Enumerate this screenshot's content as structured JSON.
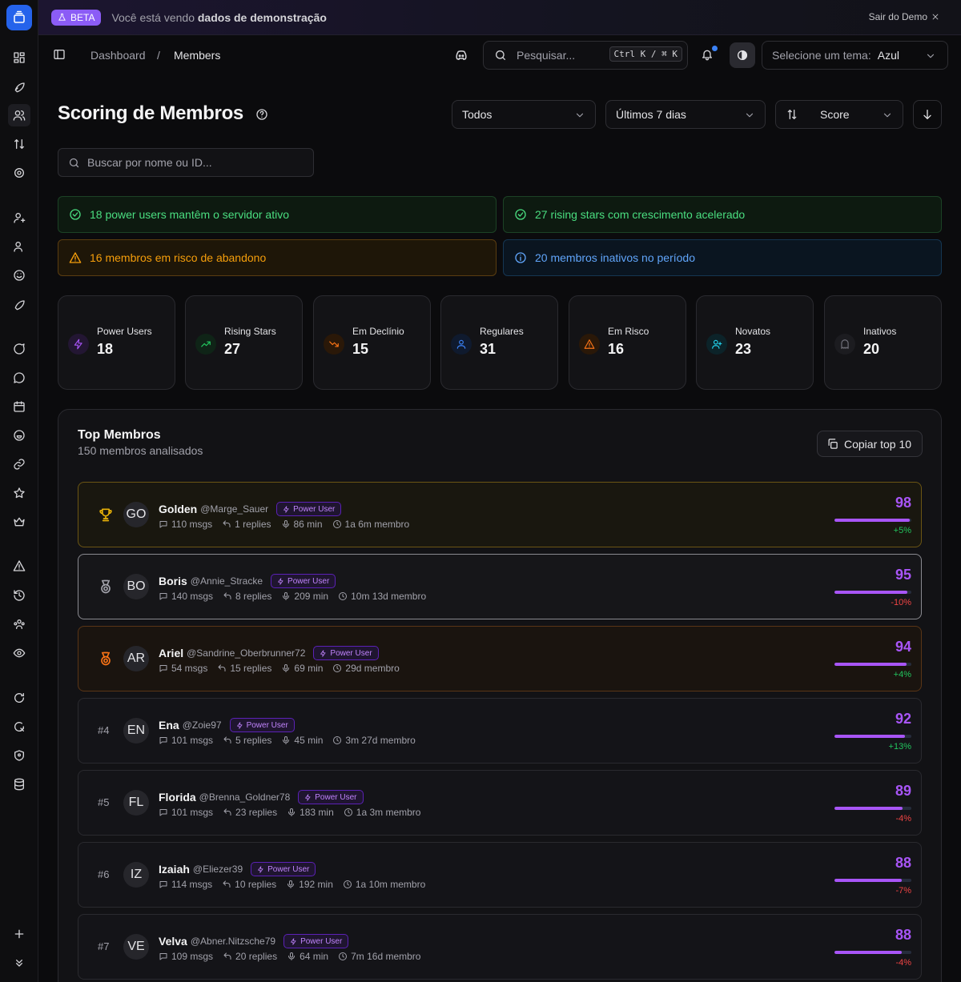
{
  "banner": {
    "beta_label": "BETA",
    "text_prefix": "Você está vendo ",
    "text_bold": "dados de demonstração",
    "exit_label": "Sair do Demo"
  },
  "breadcrumb": {
    "root": "Dashboard",
    "separator": "/",
    "current": "Members"
  },
  "search": {
    "placeholder": "Pesquisar...",
    "shortcut": "Ctrl K / ⌘ K"
  },
  "theme": {
    "label": "Selecione um tema:",
    "value": "Azul"
  },
  "page": {
    "title": "Scoring de Membros",
    "filter_type": "Todos",
    "filter_period": "Últimos 7 dias",
    "sort_label": "Score",
    "member_search_placeholder": "Buscar por nome ou ID..."
  },
  "alerts": {
    "power": "18 power users mantêm o servidor ativo",
    "rising": "27 rising stars com crescimento acelerado",
    "risk": "16 membros em risco de abandono",
    "inactive": "20 membros inativos no período"
  },
  "stats": [
    {
      "label": "Power Users",
      "value": "18",
      "icon": "zap-icon",
      "color": "#a855f7"
    },
    {
      "label": "Rising Stars",
      "value": "27",
      "icon": "trending-up-icon",
      "color": "#22c55e"
    },
    {
      "label": "Em Declínio",
      "value": "15",
      "icon": "trending-down-icon",
      "color": "#f97316"
    },
    {
      "label": "Regulares",
      "value": "31",
      "icon": "user-icon",
      "color": "#3b82f6"
    },
    {
      "label": "Em Risco",
      "value": "16",
      "icon": "alert-triangle-icon",
      "color": "#f97316"
    },
    {
      "label": "Novatos",
      "value": "23",
      "icon": "user-plus-icon",
      "color": "#22d3ee"
    },
    {
      "label": "Inativos",
      "value": "20",
      "icon": "ghost-icon",
      "color": "#71717a"
    }
  ],
  "top_members": {
    "title": "Top Membros",
    "subtitle": "150 membros analisados",
    "copy_label": "Copiar top 10",
    "badge_label": "Power User",
    "rows": [
      {
        "rank": "",
        "medal": "trophy-icon",
        "initials": "GO",
        "name": "Golden",
        "handle": "@Marge_Sauer",
        "msgs": "110 msgs",
        "replies": "1 replies",
        "voice": "86 min",
        "tenure": "1a 6m membro",
        "score": "98",
        "score_pct": 98,
        "delta": "+5%",
        "trend": "up"
      },
      {
        "rank": "",
        "medal": "medal-icon",
        "initials": "BO",
        "name": "Boris",
        "handle": "@Annie_Stracke",
        "msgs": "140 msgs",
        "replies": "8 replies",
        "voice": "209 min",
        "tenure": "10m 13d membro",
        "score": "95",
        "score_pct": 95,
        "delta": "-10%",
        "trend": "down"
      },
      {
        "rank": "",
        "medal": "medal-icon",
        "initials": "AR",
        "name": "Ariel",
        "handle": "@Sandrine_Oberbrunner72",
        "msgs": "54 msgs",
        "replies": "15 replies",
        "voice": "69 min",
        "tenure": "29d membro",
        "score": "94",
        "score_pct": 94,
        "delta": "+4%",
        "trend": "up"
      },
      {
        "rank": "#4",
        "medal": "",
        "initials": "EN",
        "name": "Ena",
        "handle": "@Zoie97",
        "msgs": "101 msgs",
        "replies": "5 replies",
        "voice": "45 min",
        "tenure": "3m 27d membro",
        "score": "92",
        "score_pct": 92,
        "delta": "+13%",
        "trend": "up"
      },
      {
        "rank": "#5",
        "medal": "",
        "initials": "FL",
        "name": "Florida",
        "handle": "@Brenna_Goldner78",
        "msgs": "101 msgs",
        "replies": "23 replies",
        "voice": "183 min",
        "tenure": "1a 3m membro",
        "score": "89",
        "score_pct": 89,
        "delta": "-4%",
        "trend": "down"
      },
      {
        "rank": "#6",
        "medal": "",
        "initials": "IZ",
        "name": "Izaiah",
        "handle": "@Eliezer39",
        "msgs": "114 msgs",
        "replies": "10 replies",
        "voice": "192 min",
        "tenure": "1a 10m membro",
        "score": "88",
        "score_pct": 88,
        "delta": "-7%",
        "trend": "down"
      },
      {
        "rank": "#7",
        "medal": "",
        "initials": "VE",
        "name": "Velva",
        "handle": "@Abner.Nitzsche79",
        "msgs": "109 msgs",
        "replies": "20 replies",
        "voice": "64 min",
        "tenure": "7m 16d membro",
        "score": "88",
        "score_pct": 88,
        "delta": "-4%",
        "trend": "down"
      }
    ]
  }
}
